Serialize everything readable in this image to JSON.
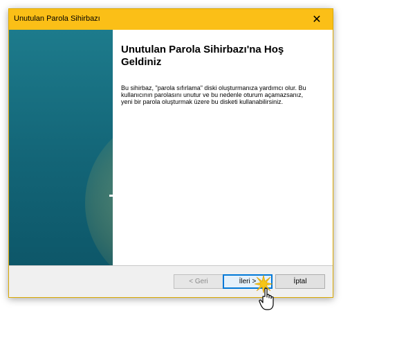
{
  "window": {
    "title": "Unutulan Parola Sihirbazı",
    "close_glyph": "✕"
  },
  "content": {
    "heading": "Unutulan Parola Sihirbazı'na Hoş Geldiniz",
    "description": "Bu sihirbaz, \"parola sıfırlama\" diski oluşturmanıza yardımcı olur. Bu kullanıcının parolasını unutur ve bu nedenle oturum açamazsanız, yeni bir parola oluşturmak üzere bu disketi kullanabilirsiniz."
  },
  "buttons": {
    "back": "< Geri",
    "next": "İleri >",
    "cancel": "İptal"
  },
  "colors": {
    "titlebar": "#fbbf17",
    "banner": "#136577",
    "focus": "#0078d7"
  },
  "icons": {
    "close": "close-icon",
    "pointer": "hand-cursor-icon",
    "click": "click-burst-icon"
  }
}
